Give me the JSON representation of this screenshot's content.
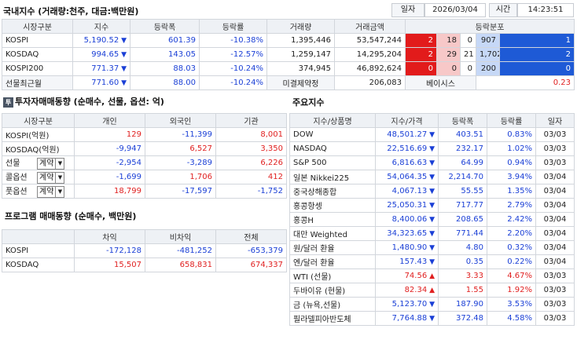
{
  "domestic": {
    "title": "국내지수 (거래량:천주, 대금:백만원)",
    "date_label": "일자",
    "date_value": "2026/03/04",
    "time_label": "시간",
    "time_value": "14:23:51",
    "headers": [
      "시장구분",
      "지수",
      "등락폭",
      "등락률",
      "거래량",
      "거래금액",
      "등락분포"
    ],
    "rows": [
      {
        "name": "KOSPI",
        "index": "5,190.52",
        "change": "601.39",
        "rate": "-10.38%",
        "volume": "1,395,446",
        "amount": "53,547,244",
        "d1": "2",
        "d2": "18",
        "d3": "0",
        "d4": "907",
        "d5": "1"
      },
      {
        "name": "KOSDAQ",
        "index": "994.65",
        "change": "143.05",
        "rate": "-12.57%",
        "volume": "1,259,147",
        "amount": "14,295,204",
        "d1": "2",
        "d2": "29",
        "d3": "21",
        "d4": "1,702",
        "d5": "2"
      },
      {
        "name": "KOSPI200",
        "index": "771.37",
        "change": "88.03",
        "rate": "-10.24%",
        "volume": "374,945",
        "amount": "46,892,624",
        "d1": "0",
        "d2": "0",
        "d3": "0",
        "d4": "200",
        "d5": "0"
      }
    ],
    "futures": {
      "name": "선물최근월",
      "index": "771.60",
      "change": "88.00",
      "rate": "-10.24%",
      "oi_label": "미결제약정",
      "oi_value": "206,083",
      "basis_label": "베이시스",
      "basis_value": "0.23"
    }
  },
  "investor": {
    "badge": "투",
    "title": "투자자매매동향 (순매수, 선물, 옵션: 억)",
    "headers": [
      "시장구분",
      "개인",
      "외국인",
      "기관"
    ],
    "rows": [
      {
        "name": "KOSPI(억원)",
        "indiv": "129",
        "foreign": "-11,399",
        "inst": "8,001"
      },
      {
        "name": "KOSDAQ(억원)",
        "indiv": "-9,947",
        "foreign": "6,527",
        "inst": "3,350"
      },
      {
        "name": "선물",
        "select": "계약",
        "indiv": "-2,954",
        "foreign": "-3,289",
        "inst": "6,226"
      },
      {
        "name": "콜옵션",
        "select": "계약",
        "indiv": "-1,699",
        "foreign": "1,706",
        "inst": "412"
      },
      {
        "name": "풋옵션",
        "select": "계약",
        "indiv": "18,799",
        "foreign": "-17,597",
        "inst": "-1,752"
      }
    ]
  },
  "program": {
    "title": "프로그램 매매동향 (순매수, 백만원)",
    "headers": [
      "",
      "차익",
      "비차익",
      "전체"
    ],
    "rows": [
      {
        "name": "KOSPI",
        "arb": "-172,128",
        "nonarb": "-481,252",
        "total": "-653,379"
      },
      {
        "name": "KOSDAQ",
        "arb": "15,507",
        "nonarb": "658,831",
        "total": "674,337"
      }
    ]
  },
  "major": {
    "title": "주요지수",
    "headers": [
      "지수/상품명",
      "지수/가격",
      "등락폭",
      "등락률",
      "일자"
    ],
    "rows": [
      {
        "name": "DOW",
        "price": "48,501.27",
        "dir": "dn",
        "change": "403.51",
        "rate": "0.83%",
        "date": "03/03"
      },
      {
        "name": "NASDAQ",
        "price": "22,516.69",
        "dir": "dn",
        "change": "232.17",
        "rate": "1.02%",
        "date": "03/03"
      },
      {
        "name": "S&P 500",
        "price": "6,816.63",
        "dir": "dn",
        "change": "64.99",
        "rate": "0.94%",
        "date": "03/03"
      },
      {
        "name": "일본 Nikkei225",
        "price": "54,064.35",
        "dir": "dn",
        "change": "2,214.70",
        "rate": "3.94%",
        "date": "03/04"
      },
      {
        "name": "중국상해종합",
        "price": "4,067.13",
        "dir": "dn",
        "change": "55.55",
        "rate": "1.35%",
        "date": "03/04"
      },
      {
        "name": "홍콩항셍",
        "price": "25,050.31",
        "dir": "dn",
        "change": "717.77",
        "rate": "2.79%",
        "date": "03/04"
      },
      {
        "name": "홍콩H",
        "price": "8,400.06",
        "dir": "dn",
        "change": "208.65",
        "rate": "2.42%",
        "date": "03/04"
      },
      {
        "name": "대만 Weighted",
        "price": "34,323.65",
        "dir": "dn",
        "change": "771.44",
        "rate": "2.20%",
        "date": "03/04"
      },
      {
        "name": "원/달러 환율",
        "price": "1,480.90",
        "dir": "dn",
        "change": "4.80",
        "rate": "0.32%",
        "date": "03/04"
      },
      {
        "name": "엔/달러 환율",
        "price": "157.43",
        "dir": "dn",
        "change": "0.35",
        "rate": "0.22%",
        "date": "03/04"
      },
      {
        "name": "WTI (선물)",
        "price": "74.56",
        "dir": "up",
        "change": "3.33",
        "rate": "4.67%",
        "date": "03/03"
      },
      {
        "name": "두바이유 (현물)",
        "price": "82.34",
        "dir": "up",
        "change": "1.55",
        "rate": "1.92%",
        "date": "03/03"
      },
      {
        "name": "금 (뉴욕,선물)",
        "price": "5,123.70",
        "dir": "dn",
        "change": "187.90",
        "rate": "3.53%",
        "date": "03/03"
      },
      {
        "name": "필라델피아반도체",
        "price": "7,764.88",
        "dir": "dn",
        "change": "372.48",
        "rate": "4.58%",
        "date": "03/03"
      }
    ]
  },
  "colors": {
    "up": "#e02020",
    "down": "#1a3fd6",
    "header_bg": "#eef1f5"
  }
}
